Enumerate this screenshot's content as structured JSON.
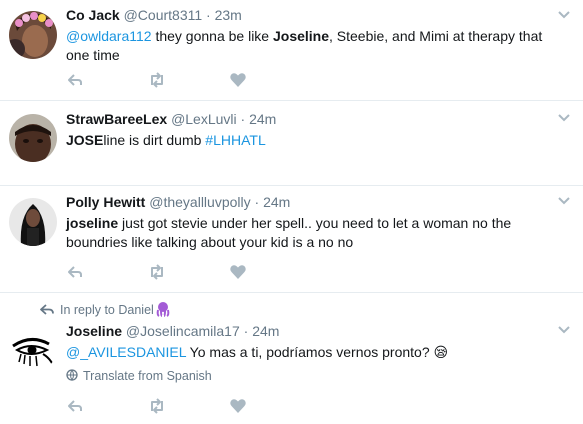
{
  "tweets": [
    {
      "display_name": "Co Jack",
      "handle": "@Court8311",
      "separator": "·",
      "time": "23m",
      "text_parts": [
        "@owldara112",
        " they gonna be like ",
        "Joseline",
        ", Steebie, and Mimi at therapy that one time"
      ]
    },
    {
      "display_name": "StrawBareeLex",
      "handle": "@LexLuvli",
      "separator": "·",
      "time": "24m",
      "text_parts": [
        "JOSE",
        "line is dirt dumb ",
        "#LHHATL"
      ]
    },
    {
      "display_name": "Polly Hewitt",
      "handle": "@theyallluvpolly",
      "separator": "·",
      "time": "24m",
      "text_parts": [
        "joseline",
        " just got stevie under her spell.. you need to let a woman no the boundries like talking about your kid is a no no"
      ]
    },
    {
      "display_name": "Joseline",
      "handle": "@Joselincamila17",
      "separator": "·",
      "time": "24m",
      "context": "In reply to Daniel",
      "text_parts": [
        "@_AVILESDANIEL",
        " Yo mas a ti, podríamos vernos pronto? ",
        "😪"
      ],
      "translate_label": "Translate from Spanish"
    }
  ],
  "icons": {
    "reply": "reply-icon",
    "retweet": "retweet-icon",
    "like": "heart-icon",
    "more": "chevron-down-icon",
    "context": "reply-arrow-icon",
    "translate": "globe-icon"
  },
  "colors": {
    "link": "#1b95e0",
    "secondary_text": "#657786",
    "action_icon": "#aab8c2",
    "divider": "#e6ecf0"
  }
}
